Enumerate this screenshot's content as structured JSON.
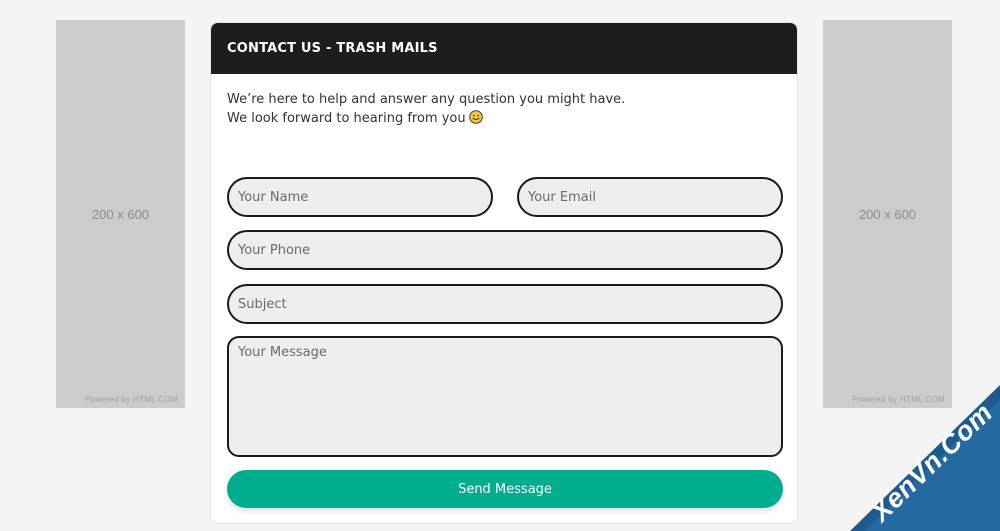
{
  "ads": {
    "left": {
      "size_label": "200 x 600",
      "powered_label": "Powered by HTML.COM"
    },
    "right": {
      "size_label": "200 x 600",
      "powered_label": "Powered by HTML.COM"
    }
  },
  "contact": {
    "title": "CONTACT US - TRASH MAILS",
    "intro_line1": "We’re here to help and answer any question you might have.",
    "intro_line2": "We look forward to hearing from you",
    "fields": {
      "name_placeholder": "Your Name",
      "email_placeholder": "Your Email",
      "phone_placeholder": "Your Phone",
      "subject_placeholder": "Subject",
      "message_placeholder": "Your Message"
    },
    "send_label": "Send Message"
  },
  "watermark": {
    "text": "XenVn.Com"
  },
  "colors": {
    "header_bg": "#1c1d1f",
    "button_bg": "#00ae8f",
    "field_bg": "#eeeeee",
    "ad_bg": "#cccccc",
    "watermark_blue": "#1d5b8f"
  },
  "icons": {
    "smiley": "smiley-face-icon"
  }
}
